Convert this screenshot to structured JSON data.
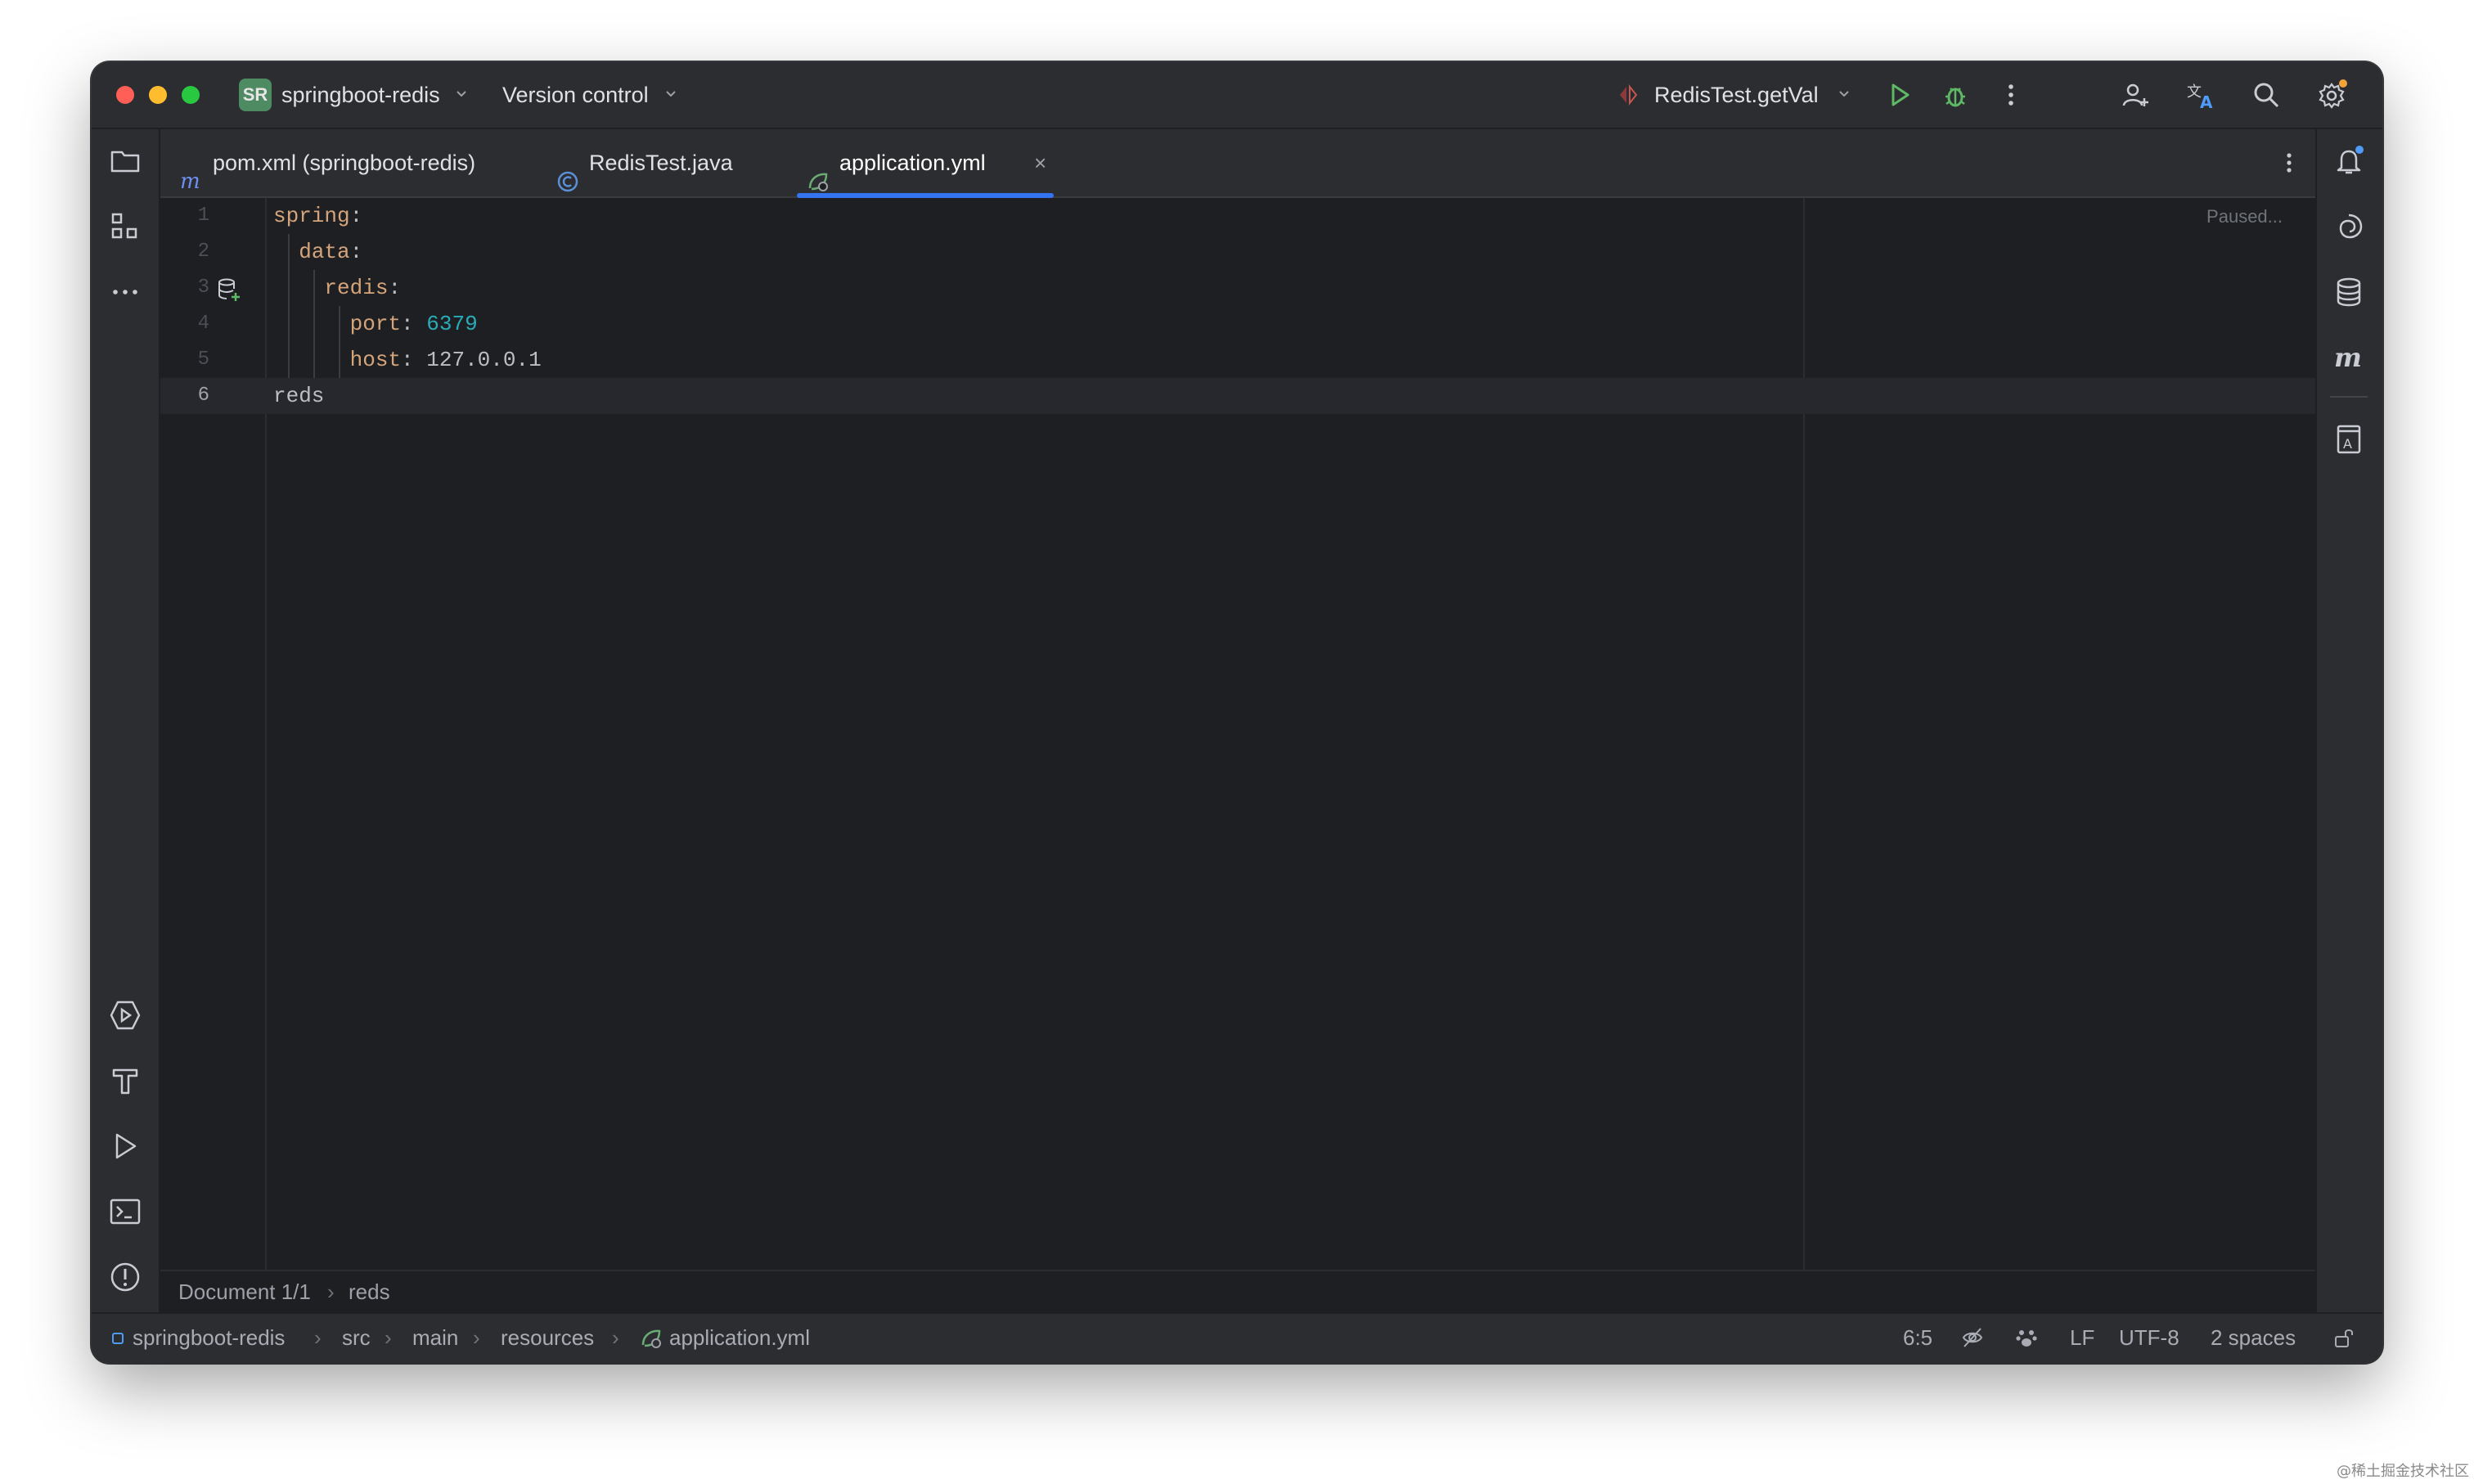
{
  "titlebar": {
    "project_badge": "SR",
    "project_name": "springboot-redis",
    "vcs_label": "Version control",
    "run_config": "RedisTest.getVal"
  },
  "tabs": [
    {
      "label": "pom.xml (springboot-redis)",
      "icon": "maven-icon",
      "active": false
    },
    {
      "label": "RedisTest.java",
      "icon": "java-class-icon",
      "active": false
    },
    {
      "label": "application.yml",
      "icon": "spring-yaml-icon",
      "active": true,
      "closable": true
    }
  ],
  "editor": {
    "status_hint": "Paused...",
    "lines": [
      {
        "num": "1",
        "key": "spring",
        "sep": ":",
        "value": ""
      },
      {
        "num": "2",
        "key": "data",
        "sep": ":",
        "value": ""
      },
      {
        "num": "3",
        "key": "redis",
        "sep": ":",
        "value": ""
      },
      {
        "num": "4",
        "key": "port",
        "sep": ": ",
        "value": "6379"
      },
      {
        "num": "5",
        "key": "host",
        "sep": ": ",
        "value": "127.0.0.1"
      },
      {
        "num": "6",
        "key": "",
        "sep": "",
        "value": "reds"
      }
    ],
    "cursor_line": "6"
  },
  "breadcrumb": {
    "document": "Document 1/1",
    "node": "reds"
  },
  "statusbar": {
    "path": [
      "springboot-redis",
      "src",
      "main",
      "resources",
      "application.yml"
    ],
    "position": "6:5",
    "line_separator": "LF",
    "encoding": "UTF-8",
    "indent": "2 spaces"
  },
  "watermark": "@稀土掘金技术社区",
  "colors": {
    "accent": "#3574f0",
    "yaml_key": "#d5a47a",
    "number": "#2aacb8",
    "run_green": "#5fb865"
  }
}
